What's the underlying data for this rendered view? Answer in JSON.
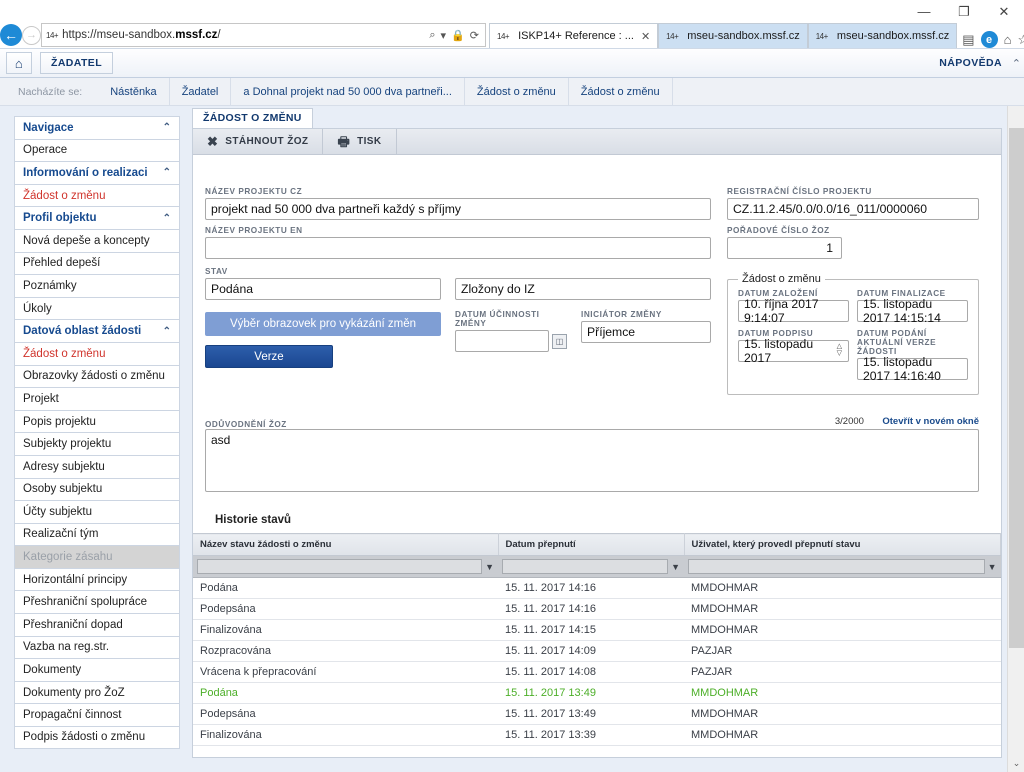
{
  "window": {
    "minimize": "—",
    "restore": "❐",
    "close": "✕"
  },
  "browser": {
    "back_icon": "←",
    "forward_icon": "→",
    "url": "https://mseu-sandbox.mssf.cz/",
    "url_bold": "mssf.cz",
    "url_prefix": "https://mseu-sandbox.",
    "search_icon": "⌕",
    "dropdown_icon": "▾",
    "lock_icon": "🔒",
    "refresh_icon": "⟳",
    "tabs": [
      {
        "title": "ISKP14+ Reference : ...",
        "active": true,
        "close": "✕"
      },
      {
        "title": "mseu-sandbox.mssf.cz",
        "active": false,
        "close": ""
      },
      {
        "title": "mseu-sandbox.mssf.cz",
        "active": false,
        "close": ""
      }
    ],
    "controls": {
      "reading_view": "▤",
      "edge": "e",
      "home": "⌂",
      "favorites": "☆",
      "settings": "⚙",
      "smiley": "☺"
    }
  },
  "appbar": {
    "home_icon": "⌂",
    "role_button": "ŽADATEL",
    "help": "NÁPOVĚDA",
    "collapse_icon": "⌃"
  },
  "breadcrumb": {
    "label": "Nacházíte se:",
    "items": [
      "Nástěnka",
      "Žadatel",
      "a Dohnal projekt nad 50 000 dva partneři...",
      "Žádost o změnu",
      "Žádost o změnu"
    ]
  },
  "sidebar": {
    "items": [
      {
        "label": "Navigace",
        "type": "group",
        "chevron": "⌃"
      },
      {
        "label": "Operace",
        "type": "item"
      },
      {
        "label": "Informování o realizaci",
        "type": "group",
        "chevron": "⌃"
      },
      {
        "label": "Žádost o změnu",
        "type": "red"
      },
      {
        "label": "Profil objektu",
        "type": "group",
        "chevron": "⌃"
      },
      {
        "label": "Nová depeše a koncepty",
        "type": "item"
      },
      {
        "label": "Přehled depeší",
        "type": "item"
      },
      {
        "label": "Poznámky",
        "type": "item"
      },
      {
        "label": "Úkoly",
        "type": "item"
      },
      {
        "label": "Datová oblast žádosti",
        "type": "group",
        "chevron": "⌃"
      },
      {
        "label": "Žádost o změnu",
        "type": "red"
      },
      {
        "label": "Obrazovky žádosti o změnu",
        "type": "item"
      },
      {
        "label": "Projekt",
        "type": "item"
      },
      {
        "label": "Popis projektu",
        "type": "item"
      },
      {
        "label": "Subjekty projektu",
        "type": "item"
      },
      {
        "label": "Adresy subjektu",
        "type": "item"
      },
      {
        "label": "Osoby subjektu",
        "type": "item"
      },
      {
        "label": "Účty subjektu",
        "type": "item"
      },
      {
        "label": "Realizační tým",
        "type": "item"
      },
      {
        "label": "Kategorie zásahu",
        "type": "disabled"
      },
      {
        "label": "Horizontální principy",
        "type": "item"
      },
      {
        "label": "Přeshraniční spolupráce",
        "type": "item"
      },
      {
        "label": "Přeshraniční dopad",
        "type": "item"
      },
      {
        "label": "Vazba na reg.str.",
        "type": "item"
      },
      {
        "label": "Dokumenty",
        "type": "item"
      },
      {
        "label": "Dokumenty pro ŽoZ",
        "type": "item"
      },
      {
        "label": "Propagační činnost",
        "type": "item"
      },
      {
        "label": "Podpis žádosti o změnu",
        "type": "item"
      }
    ]
  },
  "content": {
    "tab_label": "ŽÁDOST O ZMĚNU",
    "toolbar": [
      {
        "label": "STÁHNOUT ŽOZ",
        "icon": "✖"
      },
      {
        "label": "TISK",
        "icon": "🖶"
      }
    ],
    "fields": {
      "nazev_cz_label": "NÁZEV PROJEKTU CZ",
      "nazev_cz_value": "projekt nad 50 000 dva partneři každý s příjmy",
      "nazev_en_label": "NÁZEV PROJEKTU EN",
      "nazev_en_value": "",
      "stav_label": "STAV",
      "stav_value": "Podána",
      "stav2_value": "Zložony do IZ",
      "reg_cislo_label": "REGISTRAČNÍ ČÍSLO PROJEKTU",
      "reg_cislo_value": "CZ.11.2.45/0.0/0.0/16_011/0000060",
      "poradove_label": "POŘADOVÉ ČÍSLO ŽOZ",
      "poradove_value": "1",
      "datum_ucinnosti_label": "DATUM ÚČINNOSTI ZMĚNY",
      "datum_ucinnosti_value": "",
      "iniciator_label": "INICIÁTOR ZMĚNY",
      "iniciator_value": "Příjemce"
    },
    "buttons": {
      "vyber_obrazovek": "Výběr obrazovek pro vykázání změn",
      "verze": "Verze"
    },
    "fieldset": {
      "legend": "Žádost o změnu",
      "datum_zalozeni_label": "DATUM ZALOŽENÍ",
      "datum_zalozeni_value": "10. října 2017 9:14:07",
      "datum_finalizace_label": "DATUM FINALIZACE",
      "datum_finalizace_value": "15. listopadu 2017 14:15:14",
      "datum_podpisu_label": "DATUM PODPISU",
      "datum_podpisu_value": "15. listopadu 2017",
      "datum_podani_label": "DATUM PODÁNÍ AKTUÁLNÍ VERZE ŽÁDOSTI",
      "datum_podani_value": "15. listopadu 2017 14:16:40"
    },
    "oduvodneni": {
      "label": "ODŮVODNĚNÍ ŽOZ",
      "counter": "3/2000",
      "open_link": "Otevřít v novém okně",
      "value": "asd"
    },
    "history": {
      "title": "Historie stavů",
      "columns": [
        "Název stavu žádosti o změnu",
        "Datum přepnutí",
        "Uživatel, který provedl přepnutí stavu"
      ],
      "filters": [
        "",
        "",
        ""
      ],
      "funnel_icon": "▼",
      "rows": [
        {
          "stav": "Podána",
          "datum": "15. 11. 2017 14:16",
          "uzivatel": "MMDOHMAR",
          "highlight": false
        },
        {
          "stav": "Podepsána",
          "datum": "15. 11. 2017 14:16",
          "uzivatel": "MMDOHMAR",
          "highlight": false
        },
        {
          "stav": "Finalizována",
          "datum": "15. 11. 2017 14:15",
          "uzivatel": "MMDOHMAR",
          "highlight": false
        },
        {
          "stav": "Rozpracována",
          "datum": "15. 11. 2017 14:09",
          "uzivatel": "PAZJAR",
          "highlight": false
        },
        {
          "stav": "Vrácena k přepracování",
          "datum": "15. 11. 2017 14:08",
          "uzivatel": "PAZJAR",
          "highlight": false
        },
        {
          "stav": "Podána",
          "datum": "15. 11. 2017 13:49",
          "uzivatel": "MMDOHMAR",
          "highlight": true
        },
        {
          "stav": "Podepsána",
          "datum": "15. 11. 2017 13:49",
          "uzivatel": "MMDOHMAR",
          "highlight": false
        },
        {
          "stav": "Finalizována",
          "datum": "15. 11. 2017 13:39",
          "uzivatel": "MMDOHMAR",
          "highlight": false
        }
      ]
    }
  },
  "colors": {
    "accent_blue": "#164a8f",
    "red_link": "#d0342c",
    "green_row": "#4caf28",
    "button_dark": "#1b4791",
    "button_light": "#7f9ed4"
  },
  "scrollbar": {
    "up_arrow": "⌃",
    "down_arrow": "⌄"
  }
}
